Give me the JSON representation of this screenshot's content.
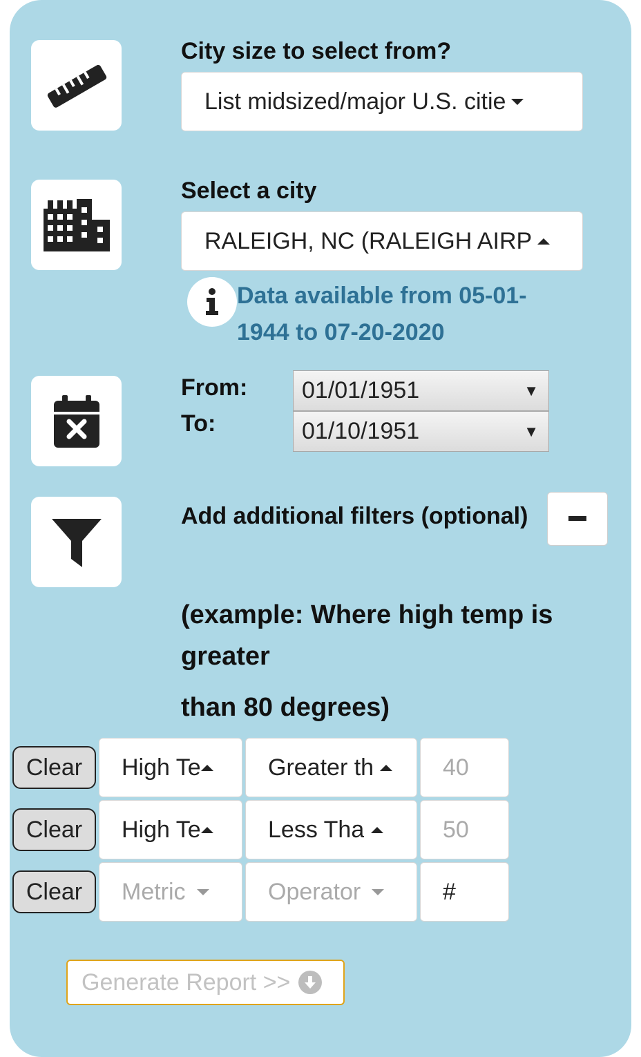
{
  "city_size": {
    "label": "City size to select from?",
    "selected": "List midsized/major U.S. citie",
    "icon": "ruler-icon"
  },
  "city": {
    "label": "Select a city",
    "selected": "RALEIGH, NC (RALEIGH AIRP",
    "icon": "city-buildings-icon",
    "info_icon": "info-icon",
    "info_text": "Data available from 05-01-1944 to 07-20-2020"
  },
  "dates": {
    "icon": "calendar-x-icon",
    "from_label": "From:",
    "to_label": "To:",
    "from_value": "01/01/1951",
    "to_value": "01/10/1951"
  },
  "filters": {
    "icon": "filter-icon",
    "label": "Add additional filters (optional)",
    "toggle": "−",
    "example_line1": "(example: Where high temp is greater",
    "example_line2": "than 80 degrees)",
    "rows": [
      {
        "clear": "Clear",
        "metric": "High Te",
        "operator": "Greater th",
        "value": "40",
        "value_is_placeholder": true
      },
      {
        "clear": "Clear",
        "metric": "High Te",
        "operator": "Less Tha",
        "value": "50",
        "value_is_placeholder": true
      },
      {
        "clear": "Clear",
        "metric": "Metric",
        "operator": "Operator",
        "value": "#",
        "value_is_placeholder": false
      }
    ]
  },
  "generate": {
    "label": "Generate Report >>",
    "icon": "download-circle-icon"
  },
  "colors": {
    "panel": "#add8e6",
    "info_text": "#2e7195",
    "generate_border": "#e0a41a"
  }
}
